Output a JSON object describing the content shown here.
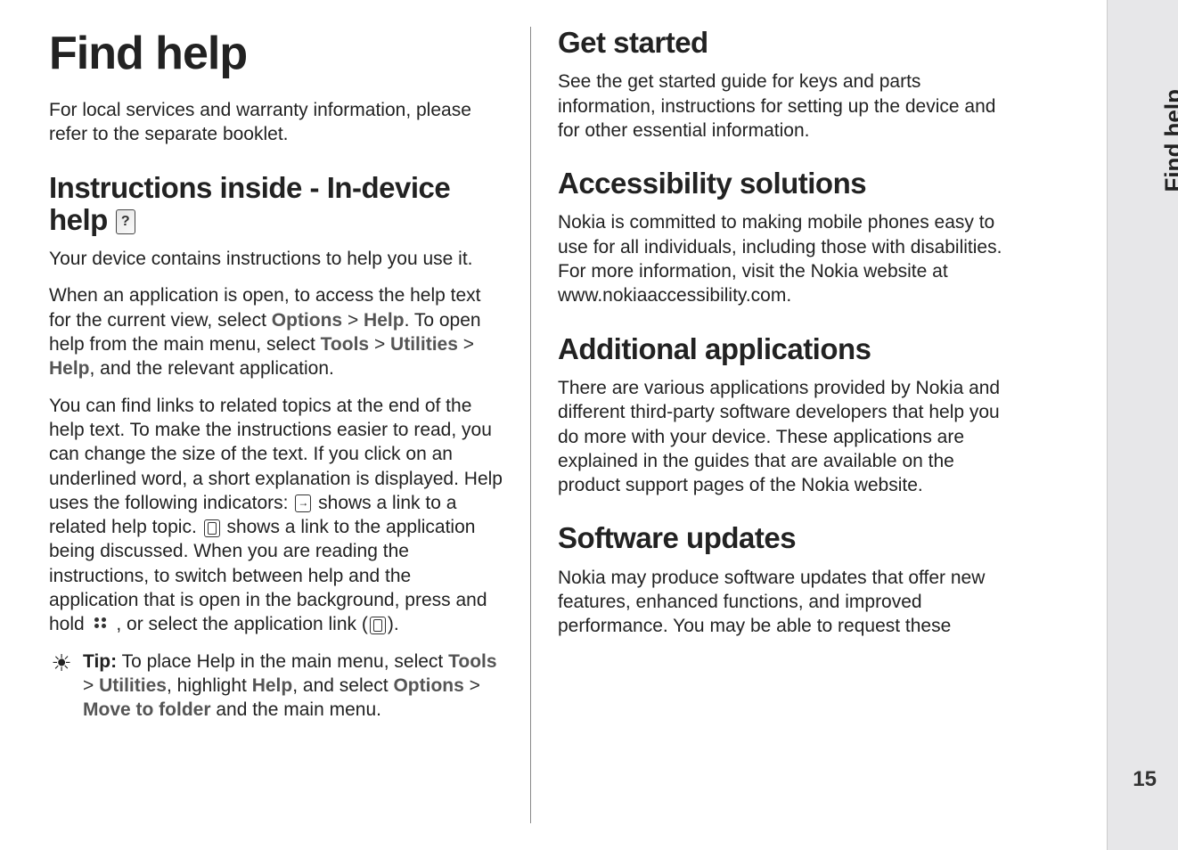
{
  "sidebar": {
    "label": "Find help"
  },
  "pageNumber": "15",
  "left": {
    "h1": "Find help",
    "intro": "For local services and warranty information, please refer to the separate booklet.",
    "h2a": "Instructions inside - In-device help ",
    "p1": "Your device contains instructions to help you use it.",
    "p2_a": "When an application is open, to access the help text for the current view, select ",
    "p2_options": "Options",
    "p2_b": " > ",
    "p2_help": "Help",
    "p2_c": ". To open help from the main menu, select ",
    "p2_tools": "Tools",
    "p2_d": " > ",
    "p2_util": "Utilities",
    "p2_e": " > ",
    "p2_help2": "Help",
    "p2_f": ", and the relevant application.",
    "p3_a": "You can find links to related topics at the end of the help text. To make the instructions easier to read, you can change the size of the text. If you click on an underlined word, a short explanation is displayed. Help uses the following indicators: ",
    "p3_b": " shows a link to a related help topic. ",
    "p3_c": " shows a link to the application being discussed. When you are reading the instructions, to switch between help and the application that is open in the background, press and hold ",
    "p3_d": " , or select the application link (",
    "p3_e": ").",
    "tip_label": "Tip:",
    "tip_a": " To place Help in the main menu, select ",
    "tip_tools": "Tools",
    "tip_b": " > ",
    "tip_util": "Utilities",
    "tip_c": ", highlight ",
    "tip_help": "Help",
    "tip_d": ", and select ",
    "tip_options": "Options",
    "tip_e": " > ",
    "tip_move": "Move to folder",
    "tip_f": " and the main menu."
  },
  "right": {
    "h2a": "Get started",
    "p1": "See the get started guide for keys and parts information, instructions for setting up the device and for other essential information.",
    "h2b": "Accessibility solutions",
    "p2": "Nokia is committed to making mobile phones easy to use for all individuals, including those with disabilities. For more information, visit the Nokia website at www.nokiaaccessibility.com.",
    "h2c": "Additional applications",
    "p3": "There are various applications provided by Nokia and different third-party software developers that help you do more with your device. These applications are explained in the guides that are available on the product support pages of the Nokia website.",
    "h2d": "Software updates",
    "p4": "Nokia may produce software updates that offer new features, enhanced functions, and improved performance. You may be able to request these"
  }
}
